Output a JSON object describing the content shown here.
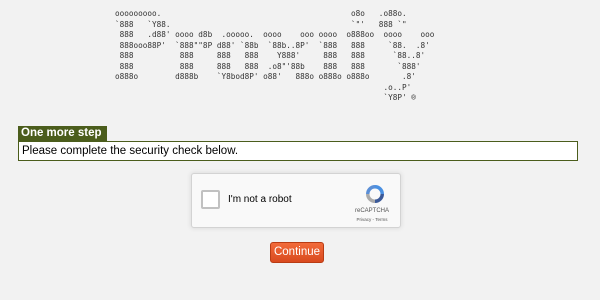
{
  "logo_ascii": "ooooooooo.                                         o8o   .o88o.\n`888   `Y88.                                       `\"'   888 `\"\n 888   .d88' oooo d8b  .ooooo.  oooo    ooo oooo  o888oo  oooo    ooo\n 888ooo88P'  `888\"\"8P d88' `88b  `88b..8P'  `888   888     `88.  .8'\n 888          888     888   888    Y888'     888   888      `88..8'\n 888          888     888   888  .o8\"'88b    888   888       `888'\no888o        d888b    `Y8bod8P' o88'   888o o888o o888o       .8'\n                                                          .o..P'\n                                                          `Y8P' ®",
  "step": {
    "title": "One more step",
    "message": "Please complete the security check below."
  },
  "recaptcha": {
    "checkbox_label": "I'm not a robot",
    "checked": false,
    "brand": "reCAPTCHA",
    "privacy": "Privacy",
    "separator": " - ",
    "terms": "Terms"
  },
  "continue_button": {
    "label": "Continue"
  },
  "colors": {
    "background": "#f2f2f2",
    "step_accent": "#4b5d1c",
    "button": "#e4572e"
  },
  "icons": {
    "recaptcha": "recaptcha-logo-icon"
  }
}
